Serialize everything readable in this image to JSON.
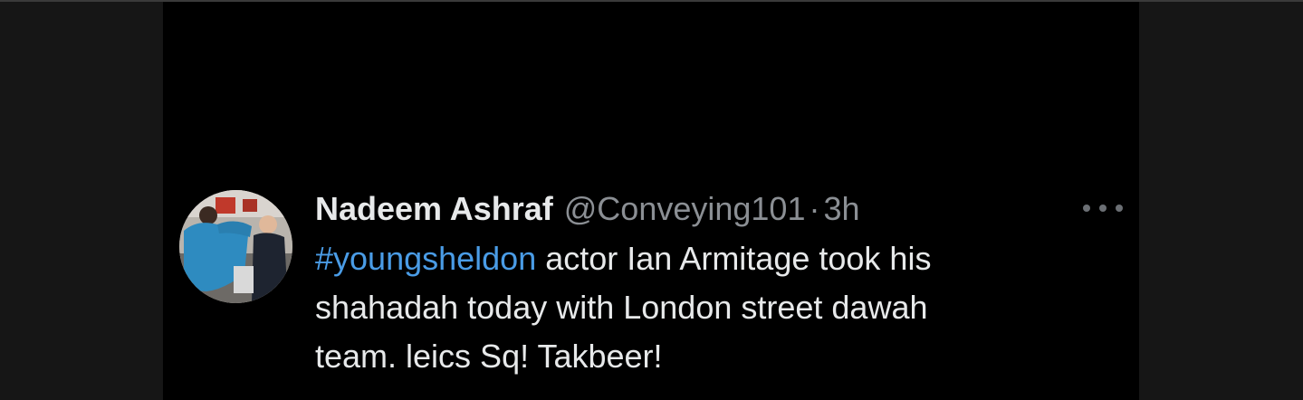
{
  "tweet": {
    "display_name": "Nadeem Ashraf",
    "handle": "@Conveying101",
    "separator": "·",
    "timestamp": "3h",
    "hashtag": "#youngsheldon",
    "text_line_1": " actor Ian Armitage took his",
    "text_line_2": "shahadah today with London street dawah",
    "text_line_3": "team. leics Sq! Takbeer!",
    "avatar_icon": "profile-photo",
    "more_icon": "ellipsis-horizontal-icon"
  },
  "colors": {
    "background": "#000000",
    "outer_background": "#161616",
    "text": "#e7e9ea",
    "muted": "#8b8f94",
    "hashtag": "#4a9ce6"
  }
}
